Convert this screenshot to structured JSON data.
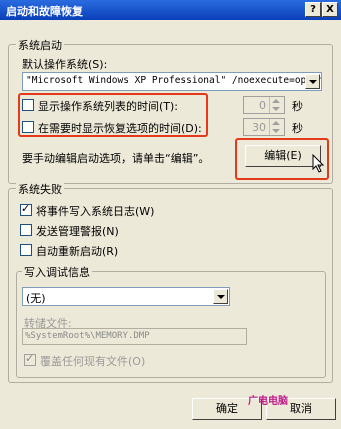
{
  "window": {
    "title": "启动和故障恢复",
    "help_btn": "?",
    "close_btn": "X"
  },
  "startup": {
    "group_title": "系统启动",
    "default_os_label": "默认操作系统(S):",
    "default_os_value": "\"Microsoft Windows XP Professional\" /noexecute=optin",
    "show_os_list_label": "显示操作系统列表的时间(T):",
    "show_os_list_checked": false,
    "show_os_list_value": "0",
    "show_recovery_label": "在需要时显示恢复选项的时间(D):",
    "show_recovery_checked": false,
    "show_recovery_value": "30",
    "seconds_unit": "秒",
    "edit_hint": "要手动编辑启动选项，请单击“编辑”。",
    "edit_button": "编辑(E)"
  },
  "failure": {
    "group_title": "系统失败",
    "write_event_label": "将事件写入系统日志(W)",
    "write_event_checked": true,
    "send_alert_label": "发送管理警报(N)",
    "send_alert_checked": false,
    "auto_restart_label": "自动重新启动(R)",
    "auto_restart_checked": false,
    "debug": {
      "group_title": "写入调试信息",
      "dump_type": "(无)",
      "dump_file_label": "转储文件:",
      "dump_file_value": "%SystemRoot%\\MEMORY.DMP",
      "overwrite_label": "覆盖任何现有文件(O)",
      "overwrite_checked": true
    }
  },
  "buttons": {
    "ok": "确定",
    "cancel": "取消"
  },
  "watermark": {
    "text": "广电电脑"
  },
  "colors": {
    "highlight": "#e43a1c",
    "titlebar": "#0a3fb8",
    "dialog_bg": "#ECE9D8"
  }
}
